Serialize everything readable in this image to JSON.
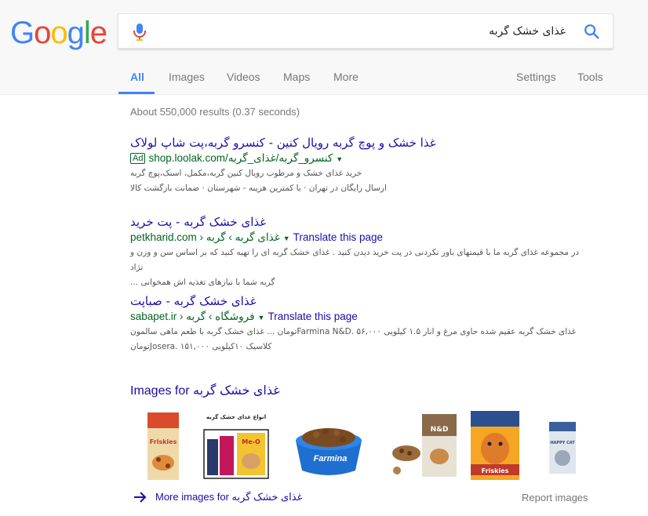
{
  "logo": {
    "text": "Google",
    "letters": [
      {
        "ch": "G",
        "color": "#4285F4"
      },
      {
        "ch": "o",
        "color": "#EA4335"
      },
      {
        "ch": "o",
        "color": "#FBBC05"
      },
      {
        "ch": "g",
        "color": "#4285F4"
      },
      {
        "ch": "l",
        "color": "#34A853"
      },
      {
        "ch": "e",
        "color": "#EA4335"
      }
    ]
  },
  "search": {
    "query": "غذای خشک گربه",
    "mic_icon": "microphone-icon",
    "search_icon": "search-icon"
  },
  "tabs": [
    {
      "label": "All",
      "active": true
    },
    {
      "label": "Images",
      "active": false
    },
    {
      "label": "Videos",
      "active": false
    },
    {
      "label": "Maps",
      "active": false
    },
    {
      "label": "More",
      "active": false
    }
  ],
  "tools": {
    "settings": "Settings",
    "tools": "Tools"
  },
  "stats": "About 550,000 results (0.37 seconds)",
  "results": [
    {
      "title": "غذا خشک و پوچ گربه رویال کنین - کنسرو گربه،پت شاپ لولاک",
      "is_ad": true,
      "ad_label": "Ad",
      "url": "shop.loolak.com/کنسرو_گربه/غذای_گربه",
      "translate": "",
      "snippet_lines": [
        "خرید غذای خشک و مرطوب رویال کنین گربه،مکمل، اسنک،پوچ گربه",
        "ارسال رایگان در تهران · با کمترین هزینه - شهرستان · ضمانت بازگشت کالا"
      ]
    },
    {
      "title": "غذای خشک گربه - پت خرید",
      "is_ad": false,
      "url": "petkharid.com › غذای گربه › گربه",
      "translate": "Translate this page",
      "snippet_lines": [
        "در مجموعه غذای گربه ما با قیمتهای باور نکردنی در پت خرید دیدن کنید . غذای خشک گربه ای را تهیه کنید که بر اساس سن و وزن و نژاد",
        "گربه شما با نیازهای تغذیه اش همخوانی ..."
      ]
    },
    {
      "title": "غذای خشک گربه - صباپت",
      "is_ad": false,
      "url": "sabapet.ir › فروشگاه › گربه",
      "translate": "Translate this page",
      "snippet_lines": [
        "غذای خشک گربه عقیم شده حاوی مرغ و انار ۱.۵ کیلویی Farmina N&D. ۵۶,۰۰۰تومان ... غذای خشک گربه با طعم ماهی سالمون",
        "کلاسیک ۱۰کیلویی Josera. ۱۵۱,۰۰۰تومان"
      ]
    }
  ],
  "images_section": {
    "title": "Images for غذای خشک گربه",
    "thumb_labels": [
      "Friskies",
      "انواع غذای خشک گربه",
      "Me-O",
      "Farmina",
      "N&D",
      "Friskies",
      "HAPPY CAT"
    ],
    "more_label": "More images for غذای خشک گربه",
    "report_label": "Report images"
  },
  "colors": {
    "link": "#1a0dab",
    "url_green": "#006621",
    "snippet": "#545454",
    "tab_active": "#4285f4",
    "muted": "#777777"
  }
}
